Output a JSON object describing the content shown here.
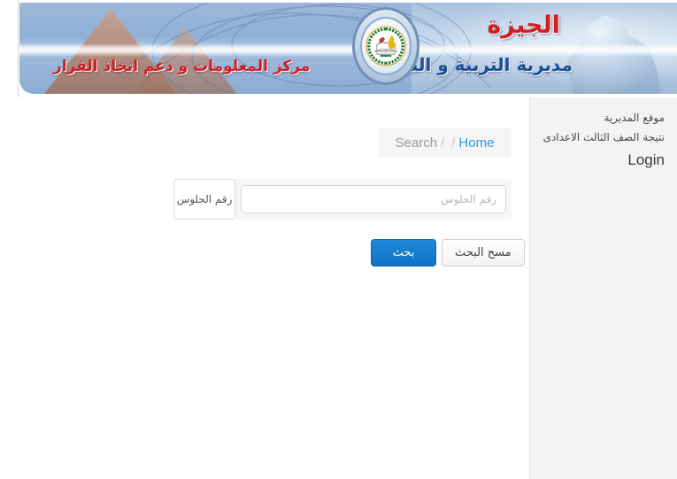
{
  "banner": {
    "title_main": "الجيزة",
    "title_sub": "مديرية التربية و التعليم",
    "title_left": "مركز المعلومات و دعم اتخاذ القرار",
    "emblem_name": "ministry-of-education-emblem",
    "colors": {
      "title_red": "#cf1f24",
      "title_blue": "#1b4f92",
      "sky": "#9db7d9"
    }
  },
  "sidebar": {
    "items": [
      {
        "label": "موقع المديرية",
        "name": "sidebar-item-directorate-site"
      },
      {
        "label": "نتيجة الصف الثالث الاعدادى",
        "name": "sidebar-item-grade3-result"
      },
      {
        "label": "Login",
        "name": "sidebar-item-login"
      }
    ],
    "background": "#f3f3f3"
  },
  "breadcrumb": {
    "items": [
      "Search",
      "",
      "Home"
    ],
    "separator": "/",
    "active": "Home",
    "active_color": "#2e9bdd",
    "muted_color": "#9a9a9a"
  },
  "form": {
    "label": "رقم الجلوس",
    "placeholder": "رقم الجلوس",
    "value": ""
  },
  "buttons": {
    "submit": "بحث",
    "reset": "مسح البحث",
    "submit_color": "#0d72c4"
  }
}
